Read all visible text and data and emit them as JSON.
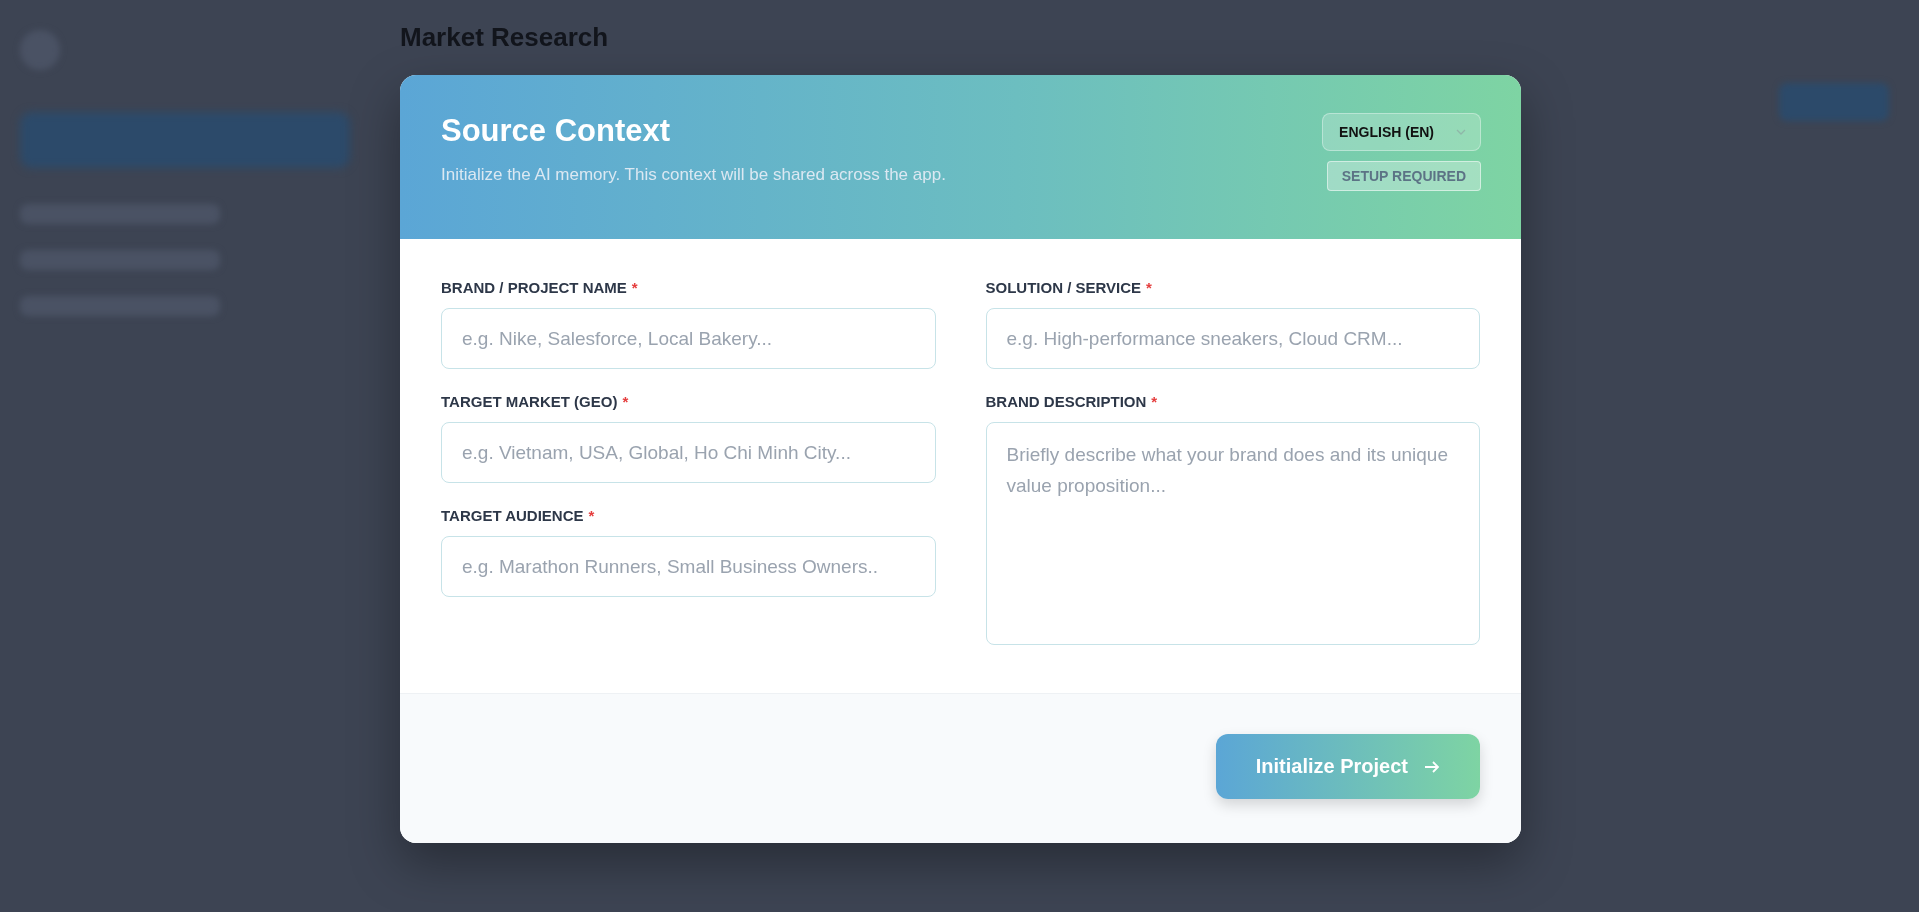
{
  "background": {
    "page_title": "Market Research"
  },
  "modal": {
    "title": "Source Context",
    "subtitle": "Initialize the AI memory. This context will be shared across the app.",
    "language": "ENGLISH (EN)",
    "status_badge": "SETUP REQUIRED",
    "left_column": [
      {
        "kind": "input",
        "label": "BRAND / PROJECT NAME",
        "required_mark": "*",
        "placeholder": "e.g. Nike, Salesforce, Local Bakery..."
      },
      {
        "kind": "input",
        "label": "TARGET MARKET (GEO)",
        "required_mark": "*",
        "placeholder": "e.g. Vietnam, USA, Global, Ho Chi Minh City..."
      },
      {
        "kind": "input",
        "label": "TARGET AUDIENCE",
        "required_mark": "*",
        "placeholder": "e.g. Marathon Runners, Small Business Owners.."
      }
    ],
    "right_column": [
      {
        "kind": "input",
        "label": "SOLUTION / SERVICE",
        "required_mark": "*",
        "placeholder": "e.g. High-performance sneakers, Cloud CRM..."
      },
      {
        "kind": "textarea",
        "label": "BRAND DESCRIPTION",
        "required_mark": "*",
        "placeholder": "Briefly describe what your brand does and its unique value proposition..."
      }
    ],
    "submit_button": "Initialize Project"
  }
}
